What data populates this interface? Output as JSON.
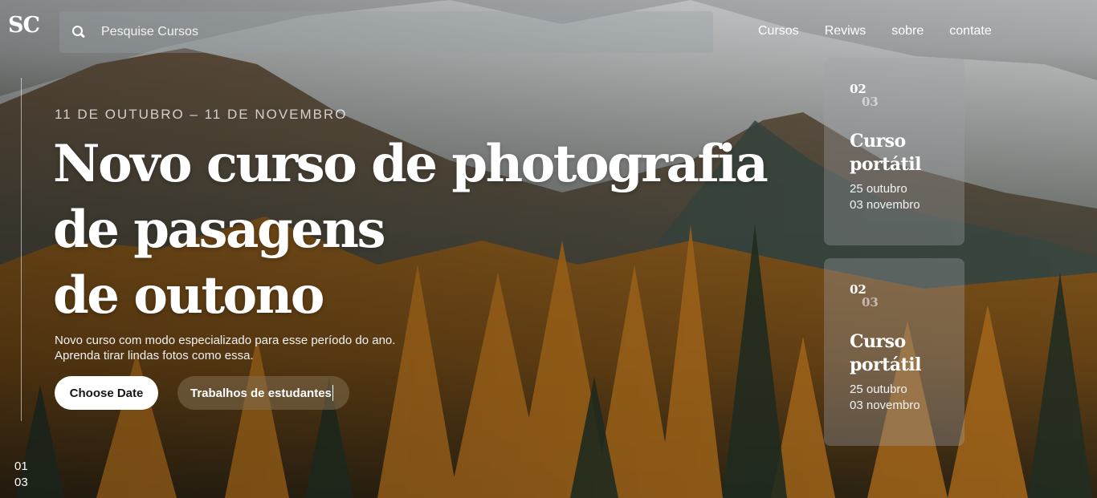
{
  "header": {
    "logo": "SC",
    "search_placeholder": "Pesquise Cursos",
    "nav": [
      "Cursos",
      "Reviws",
      "sobre",
      "contate"
    ]
  },
  "hero": {
    "dates": "11 DE OUTUBRO – 11 DE NOVEMBRO",
    "title_lines": [
      "Novo curso de photografia",
      "de pasagens",
      "de outono"
    ],
    "description_lines": [
      "Novo curso com modo especializado para esse período do ano.",
      "Aprenda tirar lindas fotos como essa."
    ],
    "primary_button": "Choose Date",
    "secondary_button": "Trabalhos de estudantes"
  },
  "pager": {
    "current": "01",
    "total": "03"
  },
  "cards": [
    {
      "num_current": "02",
      "num_total": "03",
      "title_lines": [
        "Curso",
        "portátil"
      ],
      "date_start": "25 outubro",
      "date_end": "03 novembro"
    },
    {
      "num_current": "02",
      "num_total": "03",
      "title_lines": [
        "Curso",
        "portátil"
      ],
      "date_start": "25 outubro",
      "date_end": "03 novembro"
    }
  ],
  "icons": {
    "search": "search-icon"
  },
  "colors": {
    "primary_button_bg": "#ffffff",
    "secondary_button_bg": "#826e50"
  }
}
